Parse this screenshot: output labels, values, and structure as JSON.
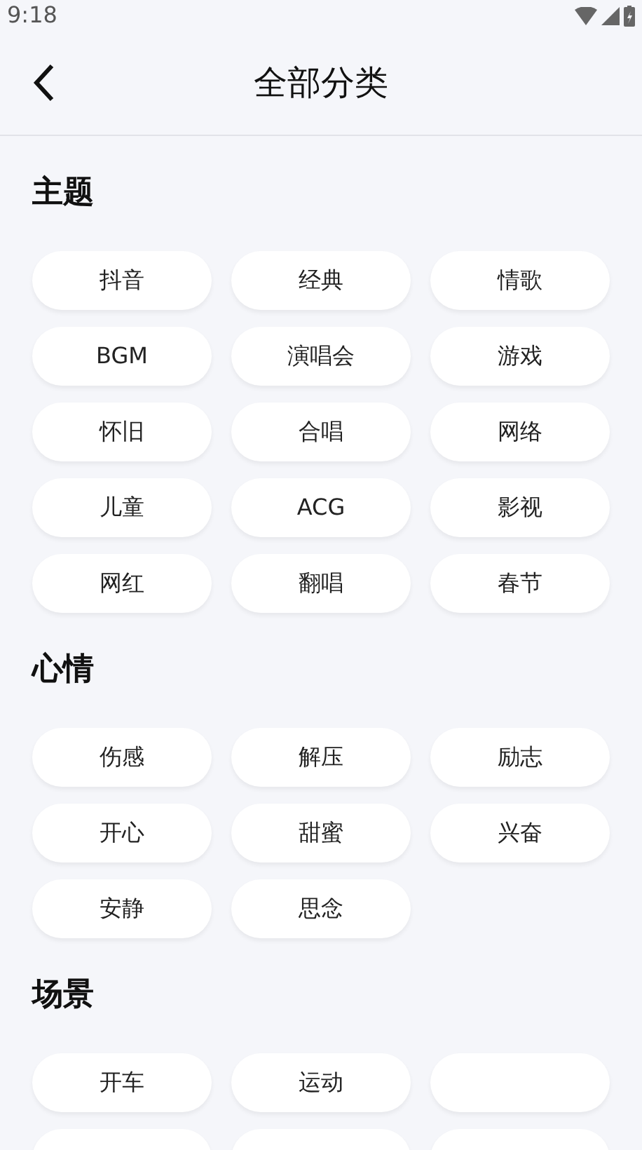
{
  "status_bar": {
    "time": "9:18"
  },
  "header": {
    "title": "全部分类"
  },
  "sections": [
    {
      "title": "主题",
      "tags": [
        {
          "label": "抖音"
        },
        {
          "label": "经典"
        },
        {
          "label": "情歌"
        },
        {
          "label": "BGM"
        },
        {
          "label": "演唱会"
        },
        {
          "label": "游戏"
        },
        {
          "label": "怀旧"
        },
        {
          "label": "合唱"
        },
        {
          "label": "网络"
        },
        {
          "label": "儿童"
        },
        {
          "label": "ACG"
        },
        {
          "label": "影视"
        },
        {
          "label": "网红"
        },
        {
          "label": "翻唱"
        },
        {
          "label": "春节"
        }
      ]
    },
    {
      "title": "心情",
      "tags": [
        {
          "label": "伤感"
        },
        {
          "label": "解压"
        },
        {
          "label": "励志"
        },
        {
          "label": "开心"
        },
        {
          "label": "甜蜜"
        },
        {
          "label": "兴奋"
        },
        {
          "label": "安静"
        },
        {
          "label": "思念"
        }
      ]
    },
    {
      "title": "场景",
      "tags": [
        {
          "kind": "text",
          "label": "开车"
        },
        {
          "kind": "text",
          "label": "运动"
        },
        {
          "kind": "blank"
        },
        {
          "kind": "blank"
        },
        {
          "kind": "blank"
        },
        {
          "kind": "blank"
        }
      ]
    }
  ]
}
